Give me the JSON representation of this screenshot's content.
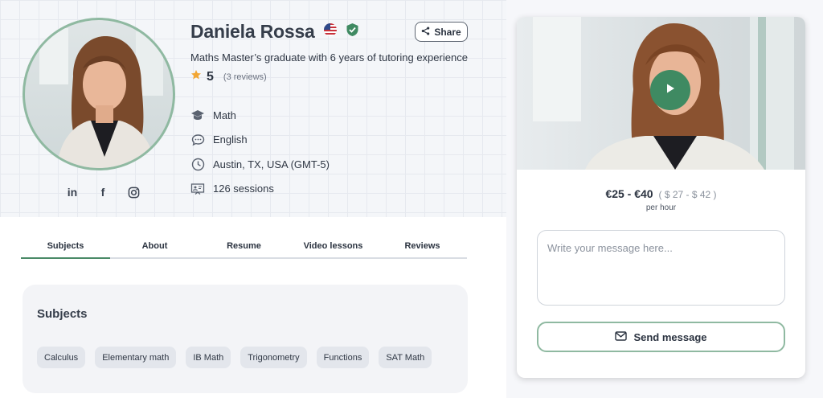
{
  "profile": {
    "name": "Daniela Rossa",
    "tagline": "Maths Master’s graduate with 6 years of tutoring experience",
    "rating": "5",
    "reviews": "(3 reviews)",
    "share_label": "Share"
  },
  "social": [
    "in",
    "f",
    "instagram"
  ],
  "facts": [
    {
      "icon": "graduation-cap-icon",
      "text": "Math"
    },
    {
      "icon": "speech-bubble-icon",
      "text": "English"
    },
    {
      "icon": "clock-icon",
      "text": "Austin, TX, USA (GMT-5)"
    },
    {
      "icon": "presentation-icon",
      "text": "126 sessions"
    }
  ],
  "tabs": [
    "Subjects",
    "About",
    "Resume",
    "Video lessons",
    "Reviews"
  ],
  "subjects": {
    "title": "Subjects",
    "chips": [
      "Calculus",
      "Elementary math",
      "IB Math",
      "Trigonometry",
      "Functions",
      "SAT Math"
    ]
  },
  "pricing": {
    "main": "€25 - €40",
    "alt": "( $ 27 - $ 42 )",
    "per": "per hour"
  },
  "message": {
    "placeholder": "Write your message here...",
    "send_label": "Send message"
  },
  "colors": {
    "accent": "#3f8a62",
    "accent_light": "#8fb9a1",
    "star": "#f2a634"
  }
}
